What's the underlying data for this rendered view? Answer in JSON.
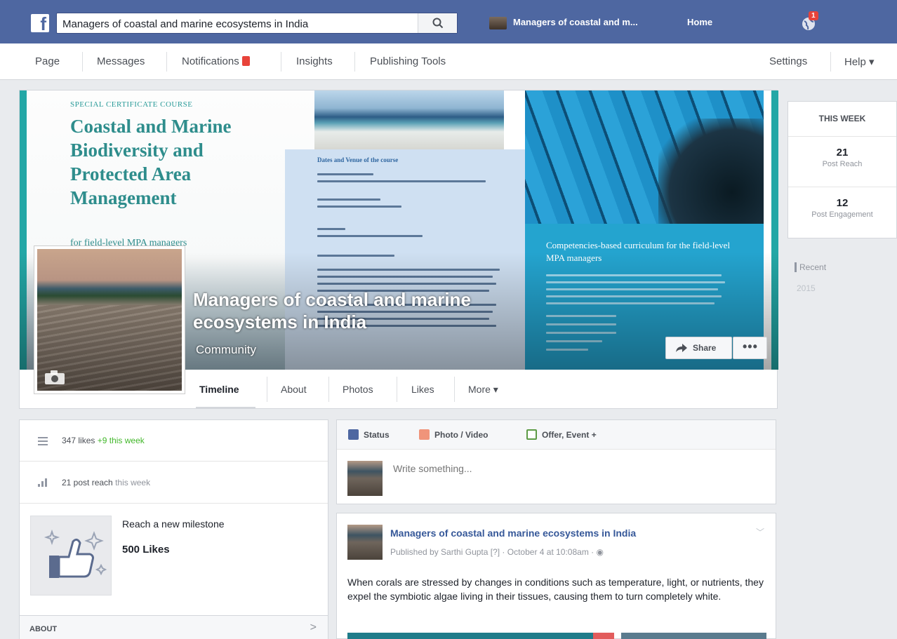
{
  "topbar": {
    "search_value": "Managers of coastal and marine ecosystems in India",
    "page_shortcut": "Managers of coastal and m...",
    "home": "Home",
    "notifications_count": "1",
    "brand_color": "#4e67a1"
  },
  "pagenav": {
    "page": "Page",
    "messages": "Messages",
    "notifications": "Notifications",
    "insights": "Insights",
    "publishing_tools": "Publishing Tools",
    "settings": "Settings",
    "help": "Help ▾"
  },
  "cover": {
    "special": "SPECIAL CERTIFICATE COURSE",
    "course_title": "Coastal and Marine Biodiversity and Protected Area Management",
    "course_sub": "for field-level MPA managers",
    "info_heading": "Dates and Venue of the course",
    "curriculum": "Competencies-based curriculum for the field-level MPA managers"
  },
  "page": {
    "name": "Managers of coastal and marine ecosystems in India",
    "category": "Community",
    "share": "Share",
    "more_dots": "•••"
  },
  "tabs": [
    "Timeline",
    "About",
    "Photos",
    "Likes",
    "More ▾"
  ],
  "this_week": {
    "header": "THIS WEEK",
    "reach_value": "21",
    "reach_label": "Post Reach",
    "engagement_value": "12",
    "engagement_label": "Post Engagement"
  },
  "timeline_nav": {
    "recent": "Recent",
    "year": "2015"
  },
  "left": {
    "likes_text": "347 likes",
    "likes_delta": "+9 this week",
    "reach_text": "21 post reach",
    "reach_suffix": "this week",
    "milestone_title": "Reach a new milestone",
    "milestone_value": "500 Likes",
    "about": "ABOUT",
    "about_chevron": ">"
  },
  "composer": {
    "status": "Status",
    "photo_video": "Photo / Video",
    "offer_event": "Offer, Event +",
    "placeholder": "Write something..."
  },
  "post": {
    "author": "Managers of coastal and marine ecosystems in India",
    "meta": "Published by Sarthi Gupta [?] · October 4 at 10:08am · ◉",
    "caret": "﹀",
    "text": "When corals are stressed by changes in conditions such as temperature, light, or nutrients, they expel the symbiotic algae living in their tissues, causing them to turn completely white."
  }
}
